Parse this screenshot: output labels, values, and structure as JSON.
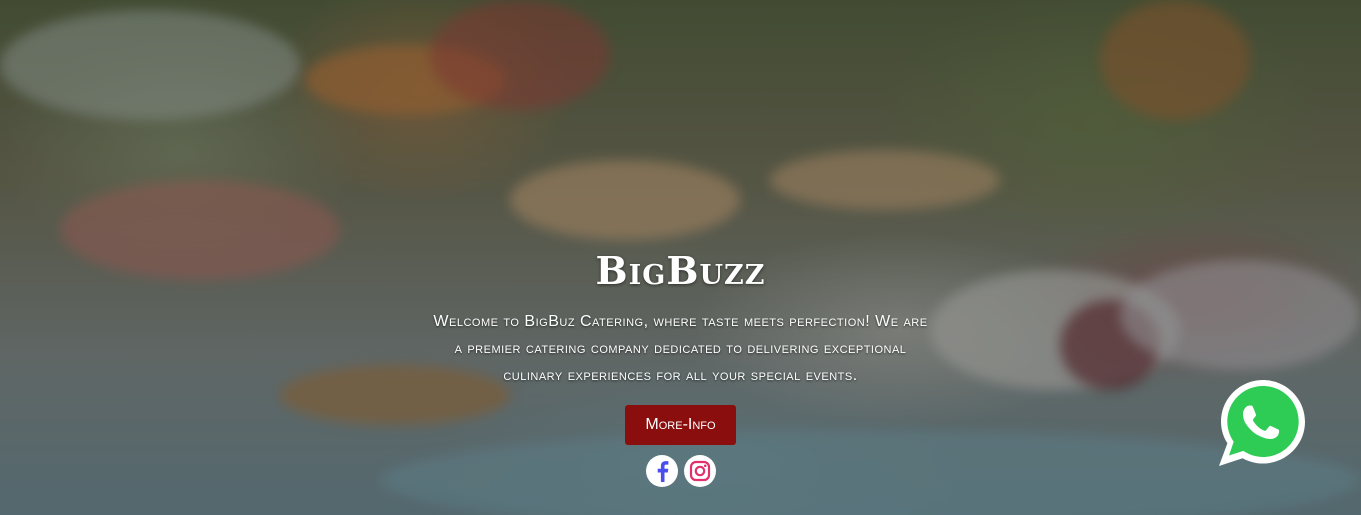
{
  "hero": {
    "brand": "BigBuzz",
    "tagline": "Welcome to BigBuz Catering, where taste meets perfection! We are a premier catering company dedicated to delivering exceptional culinary experiences for all your special events.",
    "more_button": "More-Info"
  },
  "social": {
    "items": [
      {
        "icon": "facebook-icon",
        "color": "#4a4df0"
      },
      {
        "icon": "instagram-icon",
        "color": "#e1306c"
      }
    ]
  },
  "floating": {
    "icon": "whatsapp-icon",
    "color": "#2ecc55"
  },
  "colors": {
    "button_bg": "#8b0e0e",
    "text": "#ffffff"
  }
}
